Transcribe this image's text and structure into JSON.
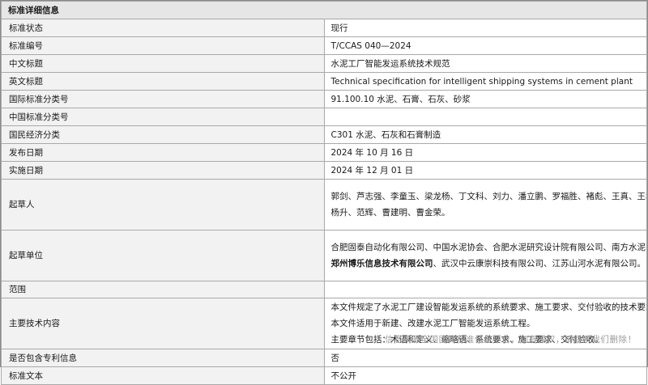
{
  "header": {
    "title": "标准详细信息"
  },
  "rows": {
    "status": {
      "label": "标准状态",
      "value": "现行"
    },
    "number": {
      "label": "标准编号",
      "value": "T/CCAS 040—2024"
    },
    "cn_title": {
      "label": "中文标题",
      "value": "水泥工厂智能发运系统技术规范"
    },
    "en_title": {
      "label": "英文标题",
      "value": "Technical specification for intelligent shipping systems in cement plant"
    },
    "ics": {
      "label": "国际标准分类号",
      "value": "91.100.10  水泥、石膏、石灰、砂浆"
    },
    "ccs": {
      "label": "中国标准分类号",
      "value": ""
    },
    "economy": {
      "label": "国民经济分类",
      "value": "C301  水泥、石灰和石膏制造"
    },
    "publish_date": {
      "label": "发布日期",
      "value": "2024 年 10 月 16 日"
    },
    "implement_date": {
      "label": "实施日期",
      "value": "2024 年 12 月 01 日"
    },
    "drafters": {
      "label": "起草人",
      "line1": "郭剑、芦志强、李童玉、梁龙杨、丁文科、刘力、潘立鹏、罗福胜、褚彪、王真、王秋富、张少亚、张雨果、宁国云、",
      "line2": "杨升、范辉、曹建明、曹金荣。"
    },
    "units": {
      "label": "起草单位",
      "line1": "合肥固泰自动化有限公司、中国水泥协会、合肥水泥研究设计院有限公司、南方水泥有限公司、中材安徽水泥有限公司、",
      "line2_bold": "郑州博乐信息技术有限公司",
      "line2_rest": "、武汉中云康崇科技有限公司、江苏山河水泥有限公司。"
    },
    "scope": {
      "label": "范围",
      "value": ""
    },
    "tech": {
      "label": "主要技术内容",
      "line1": "本文件规定了水泥工厂建设智能发运系统的系统要求、施工要求、交付验收的技术要求。",
      "line2": "本文件适用于新建、改建水泥工厂智能发运系统工程。",
      "line3": "主要章节包括：术语和定义、缩略语、系统要求、施工要求、交付验收。"
    },
    "patent": {
      "label": "是否包含专利信息",
      "value": "否"
    },
    "text": {
      "label": "标准文本",
      "value": "不公开"
    }
  },
  "watermark": "信息来源全国团体标准信息平台，如有侵权，请联系我们删除！"
}
